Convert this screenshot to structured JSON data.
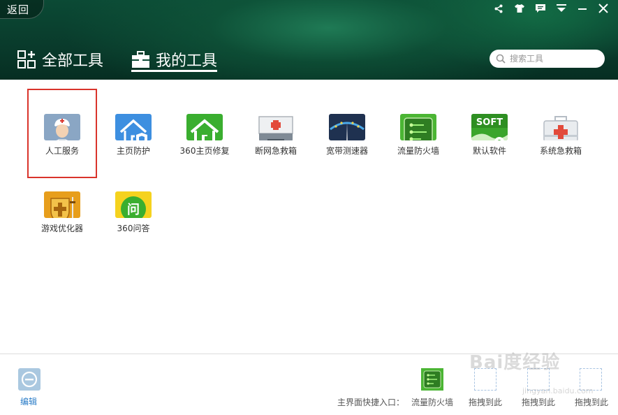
{
  "header": {
    "back_label": "返回",
    "tabs": [
      {
        "label": "全部工具",
        "active": false
      },
      {
        "label": "我的工具",
        "active": true
      }
    ],
    "search": {
      "placeholder": "搜索工具"
    },
    "top_icons": [
      "share-icon",
      "skin-icon",
      "feedback-icon",
      "menu-icon",
      "minimize-icon",
      "close-icon"
    ]
  },
  "tools": [
    {
      "label": "人工服务",
      "icon": "doctor-icon",
      "selected": true
    },
    {
      "label": "主页防护",
      "icon": "home-shield-icon"
    },
    {
      "label": "360主页修复",
      "icon": "home-repair-icon"
    },
    {
      "label": "断网急救箱",
      "icon": "network-firstaid-icon"
    },
    {
      "label": "宽带测速器",
      "icon": "speedometer-icon"
    },
    {
      "label": "流量防火墙",
      "icon": "traffic-firewall-icon"
    },
    {
      "label": "默认软件",
      "icon": "soft-icon"
    },
    {
      "label": "系统急救箱",
      "icon": "system-firstaid-icon"
    },
    {
      "label": "游戏优化器",
      "icon": "game-shield-icon"
    },
    {
      "label": "360问答",
      "icon": "qa-icon"
    }
  ],
  "footer": {
    "edit_label": "编辑",
    "quick_entry_label": "主界面快捷入口：",
    "slots": [
      {
        "label": "流量防火墙",
        "filled": true
      },
      {
        "label": "拖拽到此",
        "filled": false
      },
      {
        "label": "拖拽到此",
        "filled": false
      },
      {
        "label": "拖拽到此",
        "filled": false
      }
    ]
  },
  "watermark": {
    "text": "Bai度经验",
    "sub": "jingyan.baidu.com"
  },
  "colors": {
    "header_green": "#0b4a35",
    "selection_red": "#d9342b",
    "link_blue": "#2a7cc7"
  }
}
